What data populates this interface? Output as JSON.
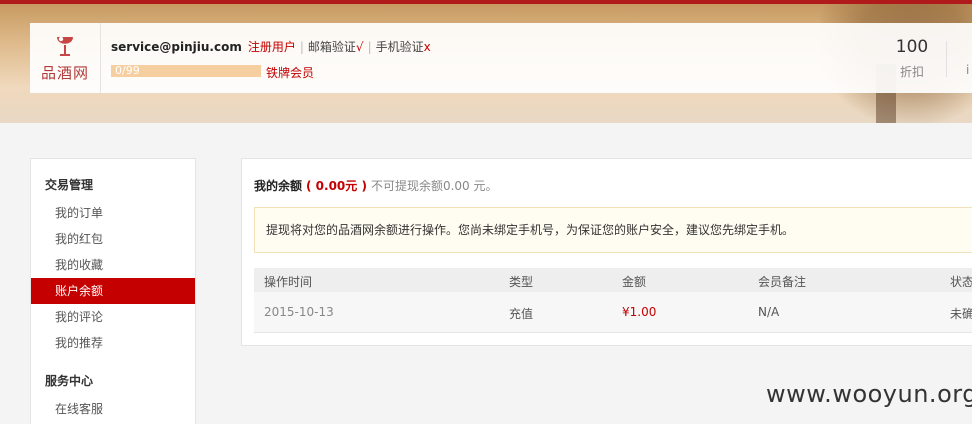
{
  "header": {
    "logo_text": "品酒网",
    "email": "service@pinjiu.com",
    "register_label": "注册用户",
    "email_verify": "邮箱验证",
    "email_verify_mark": "√",
    "phone_verify": "手机验证",
    "phone_verify_mark": "x",
    "progress_text": "0/99",
    "member_level": "铁牌会员",
    "stat_value": "100",
    "stat_label": "折扣",
    "stat2_label": "i"
  },
  "sidebar": {
    "sections": [
      {
        "title": "交易管理",
        "items": [
          {
            "label": "我的订单",
            "active": false
          },
          {
            "label": "我的红包",
            "active": false
          },
          {
            "label": "我的收藏",
            "active": false
          },
          {
            "label": "账户余额",
            "active": true
          },
          {
            "label": "我的评论",
            "active": false
          },
          {
            "label": "我的推荐",
            "active": false
          }
        ]
      },
      {
        "title": "服务中心",
        "items": [
          {
            "label": "在线客服",
            "active": false
          }
        ]
      }
    ]
  },
  "balance": {
    "label": "我的余额",
    "amount": "( 0.00元 )",
    "note": "不可提现余额0.00 元。"
  },
  "notice": "提现将对您的品酒网余额进行操作。您尚未绑定手机号，为保证您的账户安全，建议您先绑定手机。",
  "table": {
    "headers": [
      "操作时间",
      "类型",
      "金额",
      "会员备注",
      "状态"
    ],
    "rows": [
      [
        "2015-10-13",
        "充值",
        "¥1.00",
        "N/A",
        "未确"
      ]
    ]
  },
  "watermark": "www.wooyun.org",
  "colors": {
    "accent": "#c40000",
    "top_bar": "#b11a1a",
    "progress": "#f6cfa0"
  }
}
